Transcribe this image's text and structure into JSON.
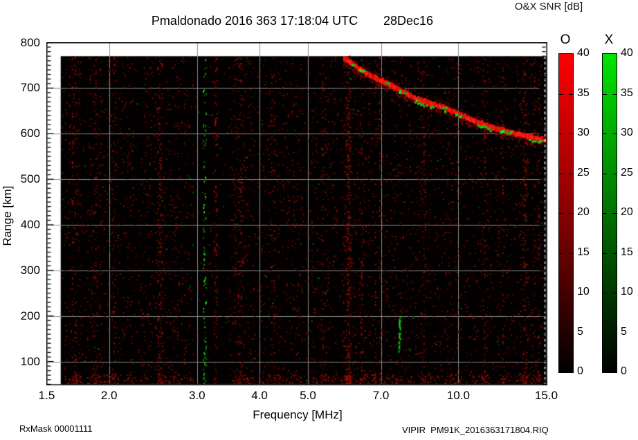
{
  "header": {
    "title": "Pmaldonado 2016 363 17:18:04 UTC",
    "date": "28Dec16",
    "colorbar_title": "O&X SNR [dB]"
  },
  "axes": {
    "x": {
      "label": "Frequency [MHz]",
      "scale": "log",
      "min": 1.5,
      "max": 15.0,
      "ticks": [
        {
          "label": "1.5",
          "value": 1.5
        },
        {
          "label": "2.0",
          "value": 2.0
        },
        {
          "label": "3.0",
          "value": 3.0
        },
        {
          "label": "4.0",
          "value": 4.0
        },
        {
          "label": "5.0",
          "value": 5.0
        },
        {
          "label": "7.0",
          "value": 7.0
        },
        {
          "label": "10.0",
          "value": 10.0
        },
        {
          "label": "15.0",
          "value": 15.0
        }
      ]
    },
    "y": {
      "label": "Range [km]",
      "min": 50,
      "max": 800,
      "minor_tick_step_km": 10,
      "ticks": [
        {
          "label": "800",
          "value": 800
        },
        {
          "label": "700",
          "value": 700
        },
        {
          "label": "600",
          "value": 600
        },
        {
          "label": "500",
          "value": 500
        },
        {
          "label": "400",
          "value": 400
        },
        {
          "label": "300",
          "value": 300
        },
        {
          "label": "200",
          "value": 200
        },
        {
          "label": "100",
          "value": 100
        }
      ]
    }
  },
  "colorbars": [
    {
      "id": "O",
      "header": "O",
      "min": 0,
      "max": 40,
      "color_top": "#ff0000",
      "color_mid": "#7a0000",
      "color_bottom": "#000000",
      "ticks": [
        {
          "label": "40",
          "value": 40
        },
        {
          "label": "35",
          "value": 35
        },
        {
          "label": "30",
          "value": 30
        },
        {
          "label": "25",
          "value": 25
        },
        {
          "label": "20",
          "value": 20
        },
        {
          "label": "15",
          "value": 15
        },
        {
          "label": "10",
          "value": 10
        },
        {
          "label": "5",
          "value": 5
        },
        {
          "label": "0",
          "value": 0
        }
      ]
    },
    {
      "id": "X",
      "header": "X",
      "min": 0,
      "max": 40,
      "color_top": "#00e400",
      "color_mid": "#006400",
      "color_bottom": "#000000",
      "ticks": [
        {
          "label": "40",
          "value": 40
        },
        {
          "label": "35",
          "value": 35
        },
        {
          "label": "30",
          "value": 30
        },
        {
          "label": "25",
          "value": 25
        },
        {
          "label": "20",
          "value": 20
        },
        {
          "label": "15",
          "value": 15
        },
        {
          "label": "10",
          "value": 10
        },
        {
          "label": "5",
          "value": 5
        },
        {
          "label": "0",
          "value": 0
        }
      ]
    }
  ],
  "footer": {
    "rx_mask": "RxMask 00001111",
    "file": "VIPIR  PM91K_2016363171804.RIQ"
  },
  "chart_data": {
    "type": "heatmap",
    "title": "Pmaldonado 2016 363 17:18:04 UTC  28Dec16",
    "xlabel": "Frequency [MHz]",
    "ylabel": "Range [km]",
    "x_scale": "log",
    "xlim": [
      1.5,
      15.0
    ],
    "ylim": [
      50,
      800
    ],
    "snr_scale_db": [
      0,
      40
    ],
    "background": "#000000",
    "grid": {
      "x_mhz": [
        2,
        3,
        4,
        5,
        7,
        10
      ],
      "y_km": [
        100,
        200,
        300,
        400,
        500,
        600,
        700
      ],
      "color": "#8c8c8c"
    },
    "data_extent": {
      "f_mhz": [
        1.6,
        15.0
      ],
      "range_km": [
        50,
        770
      ]
    },
    "echo_trace": {
      "description": "bright O-mode echo trace descending with frequency, green X-mode patches on it",
      "points_f_km": [
        [
          5.9,
          764
        ],
        [
          6.6,
          730
        ],
        [
          7.5,
          700
        ],
        [
          8.4,
          672
        ],
        [
          9.3,
          658
        ],
        [
          10.5,
          633
        ],
        [
          11.8,
          612
        ],
        [
          13.3,
          597
        ],
        [
          15.0,
          586
        ]
      ],
      "color": "#ee1414",
      "green_runs_f": [
        [
          8.2,
          8.95
        ],
        [
          10.95,
          11.65
        ],
        [
          13.9,
          14.7
        ]
      ],
      "green_patches_f": [
        6.05,
        6.35,
        7.15,
        7.65,
        9.35,
        9.95,
        12.15,
        12.6
      ]
    },
    "interference_lines": [
      {
        "f_mhz": 3.11,
        "color": "green",
        "range_km": [
          50,
          770
        ],
        "type": "speckle-column"
      },
      {
        "f_mhz": 3.27,
        "color": "red",
        "range_km": [
          50,
          770
        ],
        "type": "speckle-column"
      }
    ],
    "green_streak": {
      "f_mhz": 7.63,
      "range_km": [
        120,
        200
      ]
    },
    "noise": {
      "base_density": 0.05,
      "bottom_band_km": [
        50,
        72
      ],
      "quiet_zone_f_mhz": [
        2.95,
        3.45
      ],
      "stripes": [
        {
          "f": 1.7,
          "m": 3.0
        },
        {
          "f": 1.87,
          "m": 2.5
        },
        {
          "f": 2.03,
          "m": 2.0
        },
        {
          "f": 2.52,
          "m": 3.0
        },
        {
          "f": 2.7,
          "m": 2.0
        },
        {
          "f": 3.63,
          "m": 2.6
        },
        {
          "f": 4.23,
          "m": 2.2
        },
        {
          "f": 5.36,
          "m": 2.4
        },
        {
          "f": 5.99,
          "m": 5.5
        },
        {
          "f": 6.34,
          "m": 2.5
        },
        {
          "f": 6.87,
          "m": 2.2
        },
        {
          "f": 8.46,
          "m": 2.4
        },
        {
          "f": 9.6,
          "m": 1.8
        },
        {
          "f": 11.2,
          "m": 2.6
        },
        {
          "f": 12.1,
          "m": 2.2
        },
        {
          "f": 13.6,
          "m": 2.8
        },
        {
          "f": 14.3,
          "m": 2.4
        }
      ]
    },
    "right_dashed_line_f_mhz": 15.0
  }
}
